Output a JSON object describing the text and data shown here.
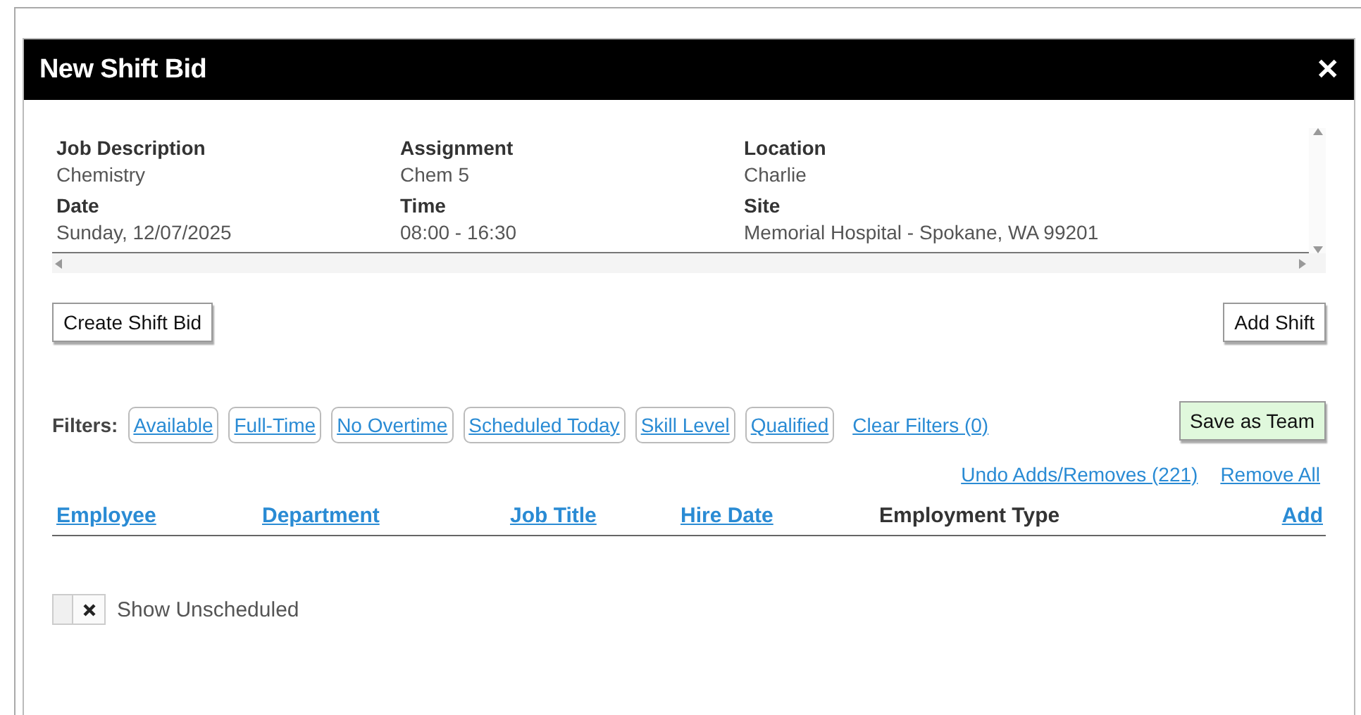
{
  "dialog": {
    "title": "New Shift Bid",
    "close": "✕"
  },
  "details": [
    {
      "label": "Job Description",
      "value": "Chemistry"
    },
    {
      "label": "Assignment",
      "value": "Chem 5"
    },
    {
      "label": "Location",
      "value": "Charlie"
    },
    {
      "label": "Date",
      "value": "Sunday, 12/07/2025"
    },
    {
      "label": "Time",
      "value": "08:00 - 16:30"
    },
    {
      "label": "Site",
      "value": "Memorial Hospital - Spokane, WA 99201"
    }
  ],
  "actions": {
    "create": "Create Shift Bid",
    "add_shift": "Add Shift"
  },
  "filters": {
    "label": "Filters:",
    "chips": [
      "Available",
      "Full-Time",
      "No Overtime",
      "Scheduled Today",
      "Skill Level",
      "Qualified"
    ],
    "clear": "Clear Filters (0)",
    "save": "Save as Team"
  },
  "links": [
    "Undo Adds/Removes (221)",
    "Remove All"
  ],
  "columns": [
    {
      "label": "Employee",
      "sortable": true
    },
    {
      "label": "Department",
      "sortable": true
    },
    {
      "label": "Job Title",
      "sortable": true
    },
    {
      "label": "Hire Date",
      "sortable": true
    },
    {
      "label": "Employment Type",
      "sortable": false
    },
    {
      "label": "Add",
      "sortable": true
    }
  ],
  "show_unscheduled": {
    "label": "Show Unscheduled",
    "on": false
  }
}
